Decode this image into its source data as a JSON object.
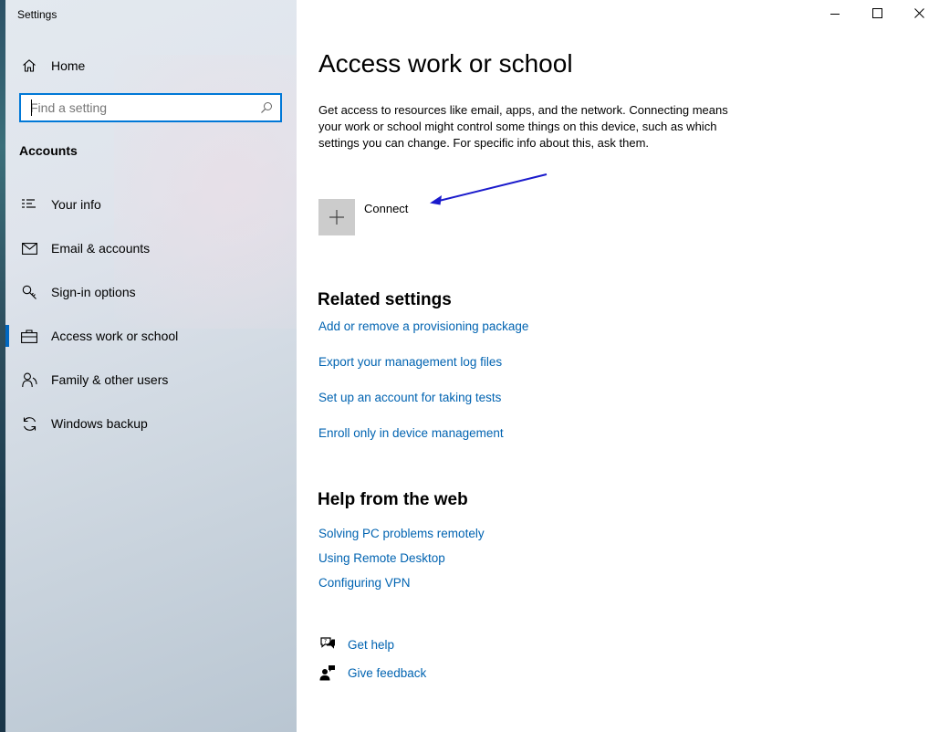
{
  "window": {
    "title": "Settings",
    "controls": {
      "minimize": "minimize",
      "maximize": "maximize",
      "close": "close"
    }
  },
  "sidebar": {
    "home_label": "Home",
    "search": {
      "placeholder": "Find a setting",
      "value": ""
    },
    "section_label": "Accounts",
    "items": [
      {
        "label": "Your info",
        "icon": "person-card-icon",
        "selected": false
      },
      {
        "label": "Email & accounts",
        "icon": "mail-icon",
        "selected": false
      },
      {
        "label": "Sign-in options",
        "icon": "key-icon",
        "selected": false
      },
      {
        "label": "Access work or school",
        "icon": "briefcase-icon",
        "selected": true
      },
      {
        "label": "Family & other users",
        "icon": "people-icon",
        "selected": false
      },
      {
        "label": "Windows backup",
        "icon": "sync-icon",
        "selected": false
      }
    ]
  },
  "main": {
    "title": "Access work or school",
    "description": "Get access to resources like email, apps, and the network. Connecting means your work or school might control some things on this device, such as which settings you can change. For specific info about this, ask them.",
    "connect_label": "Connect",
    "related": {
      "heading": "Related settings",
      "links": [
        "Add or remove a provisioning package",
        "Export your management log files",
        "Set up an account for taking tests",
        "Enroll only in device management"
      ]
    },
    "help_web": {
      "heading": "Help from the web",
      "links": [
        "Solving PC problems remotely",
        "Using Remote Desktop",
        "Configuring VPN"
      ]
    },
    "get_help": "Get help",
    "give_feedback": "Give feedback"
  },
  "colors": {
    "accent": "#0078d7",
    "link": "#0063b1",
    "annotation_arrow": "#1a1acc",
    "connect_tile": "#cccccc"
  }
}
